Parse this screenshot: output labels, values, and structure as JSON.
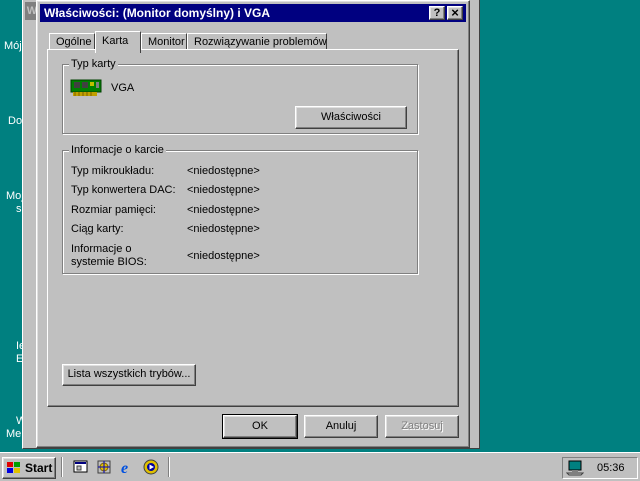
{
  "desktop": {
    "icon_labels": [
      "Mój",
      "Do",
      "Moj",
      "s",
      "Ie",
      "E",
      "W",
      "Me"
    ]
  },
  "background_window": {
    "title_letter": "W"
  },
  "dialog": {
    "title": "Właściwości: (Monitor domyślny) i VGA",
    "help_button": "?",
    "close_button": "×",
    "tabs": [
      "Ogólne",
      "Karta",
      "Monitor",
      "Rozwiązywanie problemów"
    ],
    "active_tab": "Karta",
    "adapter_type": {
      "group_label": "Typ karty",
      "adapter_name": "VGA",
      "properties_button": "Właściwości"
    },
    "adapter_info": {
      "group_label": "Informacje o karcie",
      "rows": [
        {
          "label": "Typ mikroukładu:",
          "value": "<niedostępne>"
        },
        {
          "label": "Typ konwertera DAC:",
          "value": "<niedostępne>"
        },
        {
          "label": "Rozmiar pamięci:",
          "value": "<niedostępne>"
        },
        {
          "label": "Ciąg karty:",
          "value": "<niedostępne>"
        },
        {
          "label": "Informacje o systemie BIOS:",
          "value": "<niedostępne>"
        }
      ]
    },
    "list_modes_button": "Lista wszystkich trybów...",
    "ok_button": "OK",
    "cancel_button": "Anuluj",
    "apply_button": "Zastosuj",
    "apply_enabled": false
  },
  "taskbar": {
    "start_label": "Start",
    "quick_launch": [
      "show-desktop-icon",
      "channels-icon",
      "internet-explorer-icon",
      "media-player-icon"
    ],
    "clock": "05:36"
  },
  "colors": {
    "desktop": "#008080",
    "titlebar": "#000080",
    "face": "#c0c0c0"
  }
}
